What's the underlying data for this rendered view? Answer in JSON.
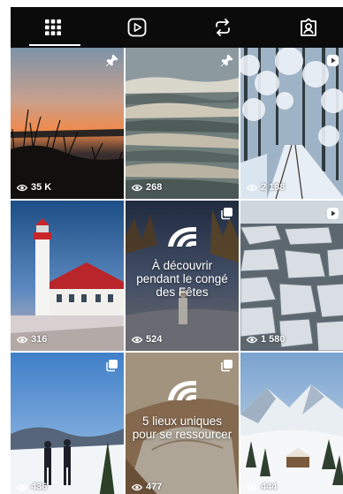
{
  "tabs": [
    {
      "name": "tab-posts",
      "icon": "grid-icon",
      "active": true
    },
    {
      "name": "tab-reels",
      "icon": "play-icon",
      "active": false
    },
    {
      "name": "tab-reposts",
      "icon": "repost-icon",
      "active": false
    },
    {
      "name": "tab-tagged",
      "icon": "tagged-person-icon",
      "active": false
    }
  ],
  "colors": {
    "tab_bar": "#0b0b0b",
    "icon": "#ffffff"
  },
  "posts": [
    {
      "views": "35 K",
      "badge": "pin-icon"
    },
    {
      "views": "268",
      "badge": "pin-icon"
    },
    {
      "views": "2 188",
      "badge": "reel-icon"
    },
    {
      "views": "316",
      "badge": "none"
    },
    {
      "views": "524",
      "badge": "carousel-icon",
      "overlay_text": "À découvrir pendant le congé des Fêtes"
    },
    {
      "views": "1 580",
      "badge": "reel-icon"
    },
    {
      "views": "436",
      "badge": "carousel-icon"
    },
    {
      "views": "477",
      "badge": "carousel-icon",
      "overlay_text": "5 lieux uniques pour se ressourcer"
    },
    {
      "views": "444",
      "badge": "none"
    }
  ]
}
